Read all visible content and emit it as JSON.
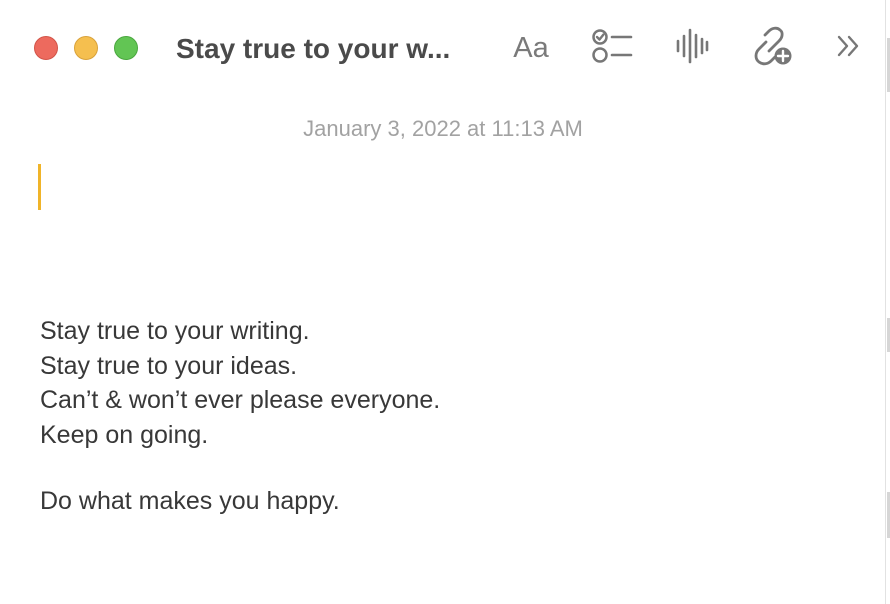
{
  "window": {
    "title": "Stay true to your w..."
  },
  "toolbar": {
    "format_label": "Aa",
    "icons": {
      "checklist": "checklist-icon",
      "audio": "audio-waveform-icon",
      "link": "add-link-icon",
      "more": "chevron-double-right-icon"
    }
  },
  "note": {
    "date": "January 3, 2022 at 11:13 AM",
    "lines": [
      "Stay true to your writing.",
      "Stay true to your ideas.",
      "Can’t & won’t ever please everyone.",
      "Keep on going.",
      "Do what makes you happy."
    ]
  },
  "colors": {
    "close": "#ed6a5e",
    "minimize": "#f5bf4f",
    "zoom": "#62c554",
    "cursor": "#f0b429",
    "date": "#a2a2a2",
    "text": "#383838"
  }
}
